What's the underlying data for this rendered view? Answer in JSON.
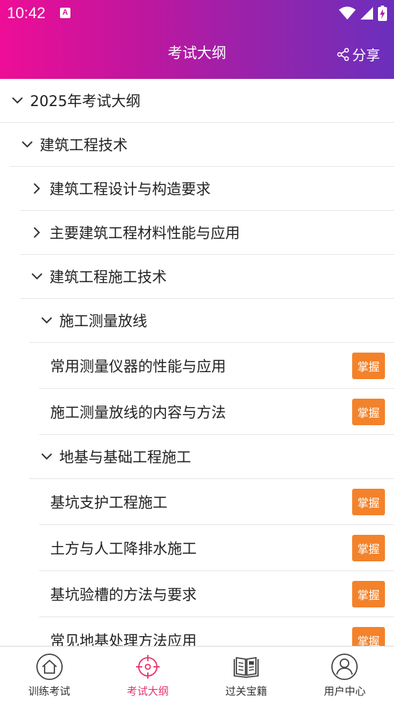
{
  "status": {
    "time": "10:42",
    "notif": "A"
  },
  "header": {
    "title": "考试大纲",
    "share_label": "分享"
  },
  "tree": {
    "root": {
      "label": "2025年考试大纲",
      "expanded": true
    },
    "l1": {
      "label": "建筑工程技术",
      "expanded": true
    },
    "l2": [
      {
        "label": "建筑工程设计与构造要求",
        "expanded": false
      },
      {
        "label": "主要建筑工程材料性能与应用",
        "expanded": false
      },
      {
        "label": "建筑工程施工技术",
        "expanded": true
      }
    ],
    "l3a": {
      "label": "施工测量放线",
      "expanded": true
    },
    "l3a_items": [
      {
        "label": "常用测量仪器的性能与应用",
        "badge": "掌握"
      },
      {
        "label": "施工测量放线的内容与方法",
        "badge": "掌握"
      }
    ],
    "l3b": {
      "label": "地基与基础工程施工",
      "expanded": true
    },
    "l3b_items": [
      {
        "label": "基坑支护工程施工",
        "badge": "掌握"
      },
      {
        "label": "土方与人工降排水施工",
        "badge": "掌握"
      },
      {
        "label": "基坑验槽的方法与要求",
        "badge": "掌握"
      },
      {
        "label": "常见地基处理方法应用",
        "badge": "掌握"
      }
    ]
  },
  "tabs": [
    {
      "label": "训练考试",
      "icon": "home-icon",
      "active": false
    },
    {
      "label": "考试大纲",
      "icon": "target-icon",
      "active": true
    },
    {
      "label": "过关宝籍",
      "icon": "book-icon",
      "active": false
    },
    {
      "label": "用户中心",
      "icon": "user-icon",
      "active": false
    }
  ],
  "colors": {
    "accent": "#e8336b",
    "badge": "#f3822a",
    "header_start": "#ee0d96",
    "header_end": "#6b2fbd"
  }
}
